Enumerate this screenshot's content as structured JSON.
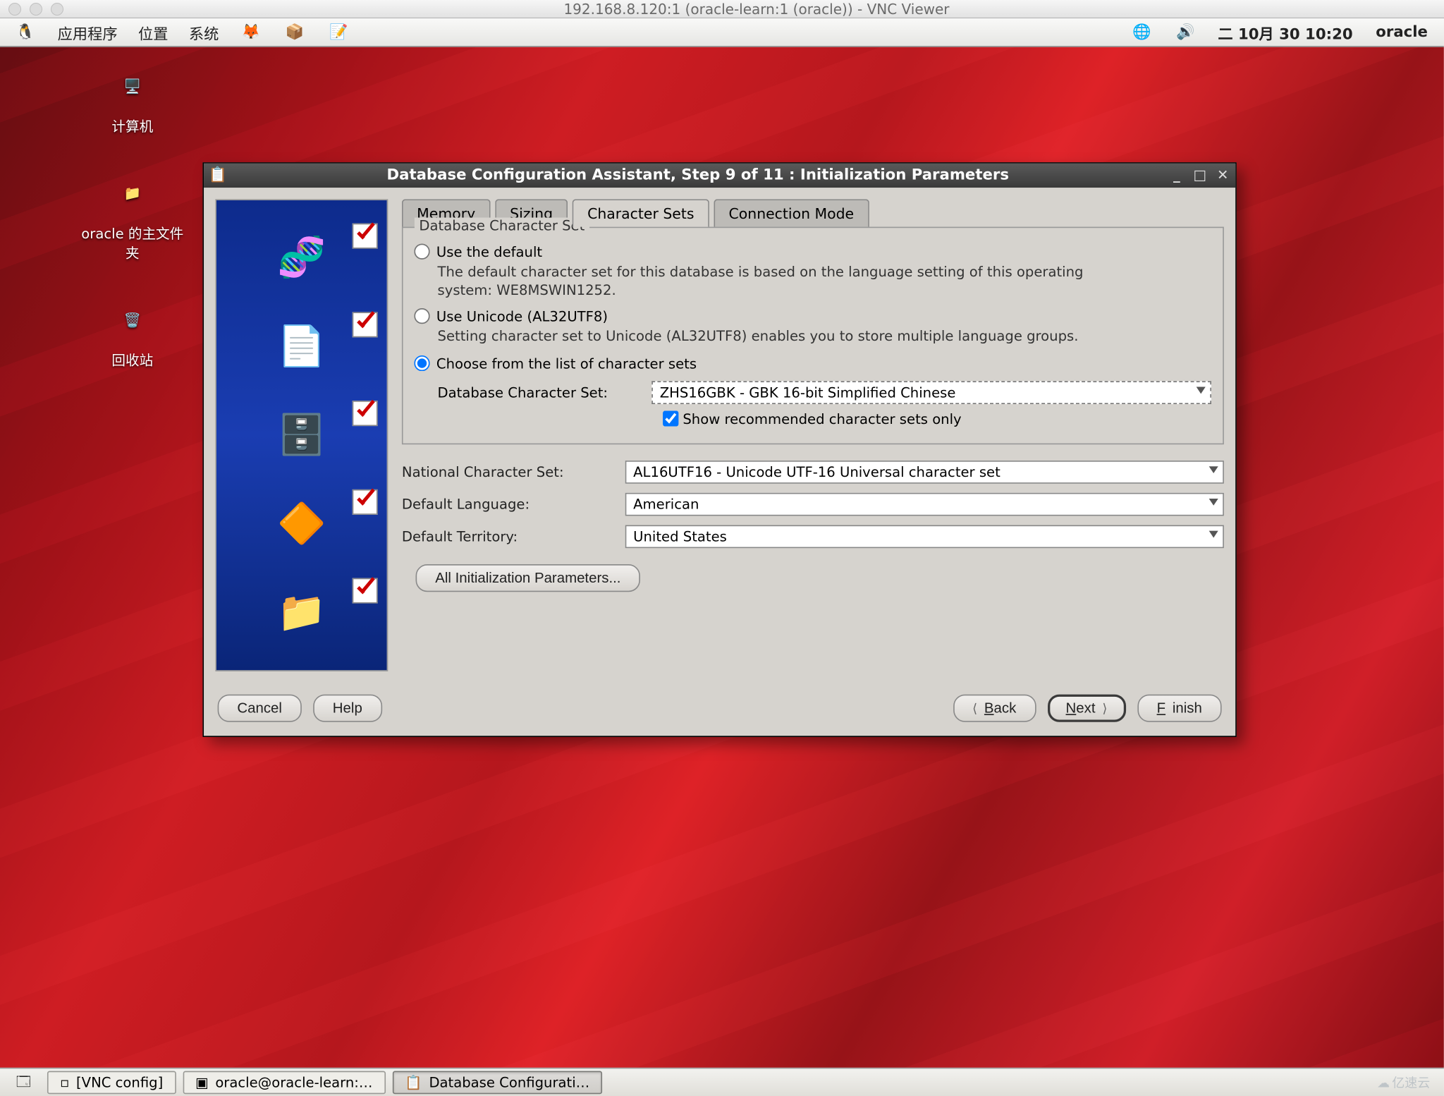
{
  "vnc": {
    "title": "192.168.8.120:1 (oracle-learn:1 (oracle)) - VNC Viewer"
  },
  "menubar": {
    "apps": "应用程序",
    "places": "位置",
    "system": "系统",
    "date": "二 10月 30 10:20",
    "user": "oracle"
  },
  "desktop_icons": {
    "computer": "计算机",
    "home": "oracle 的主文件夹",
    "trash": "回收站"
  },
  "dialog": {
    "title": "Database Configuration Assistant, Step 9 of 11 : Initialization Parameters",
    "tabs": {
      "memory": "Memory",
      "sizing": "Sizing",
      "charsets": "Character Sets",
      "connmode": "Connection Mode"
    },
    "fieldset_legend": "Database Character Set",
    "opt_default": "Use the default",
    "opt_default_desc": "The default character set for this database is based on the language setting of this operating system: WE8MSWIN1252.",
    "opt_unicode": "Use Unicode (AL32UTF8)",
    "opt_unicode_desc": "Setting character set to Unicode (AL32UTF8) enables you to store multiple language groups.",
    "opt_choose": "Choose from the list of character sets",
    "db_charset_label": "Database Character Set:",
    "db_charset_value": "ZHS16GBK - GBK 16-bit Simplified Chinese",
    "show_recommended": "Show recommended character sets only",
    "national_label": "National Character Set:",
    "national_value": "AL16UTF16 - Unicode UTF-16 Universal character set",
    "lang_label": "Default Language:",
    "lang_value": "American",
    "territory_label": "Default Territory:",
    "territory_value": "United States",
    "all_params": "All Initialization Parameters...",
    "cancel": "Cancel",
    "help": "Help",
    "back": "Back",
    "next": "Next",
    "finish": "Finish"
  },
  "taskbar": {
    "vncconfig": "[VNC config]",
    "terminal": "oracle@oracle-learn:…",
    "dbca": "Database Configurati…"
  },
  "watermark": "亿速云"
}
